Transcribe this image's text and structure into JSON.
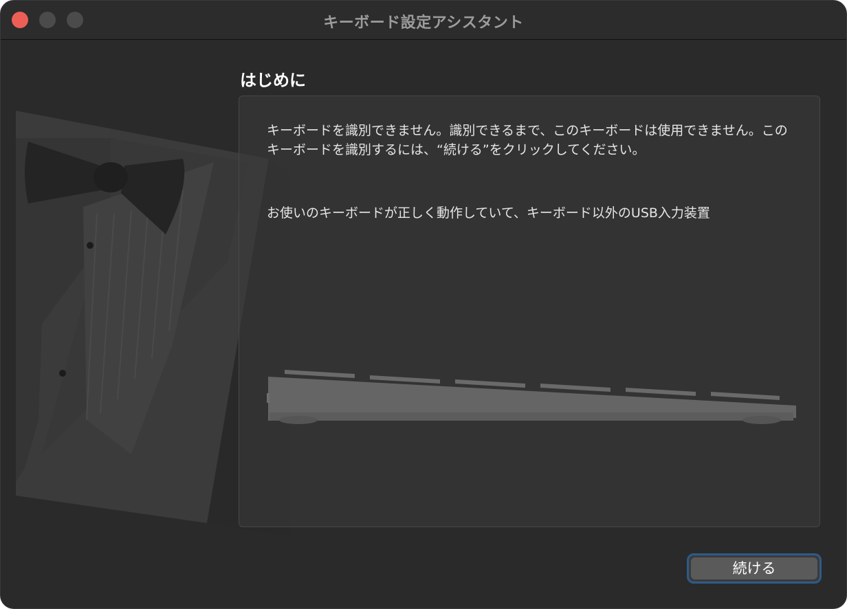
{
  "window": {
    "title": "キーボード設定アシスタント"
  },
  "section": {
    "title": "はじめに"
  },
  "content": {
    "paragraph1": "キーボードを識別できません。識別できるまで、このキーボードは使用できません。このキーボードを識別するには、“続ける”をクリックしてください。",
    "paragraph2": "お使いのキーボードが正しく動作していて、キーボード以外のUSB入力装置"
  },
  "buttons": {
    "continue_label": "続ける"
  },
  "colors": {
    "window_background": "#2a2a2a",
    "close_button": "#ec5f57",
    "focus_ring": "#2d5b8a"
  }
}
